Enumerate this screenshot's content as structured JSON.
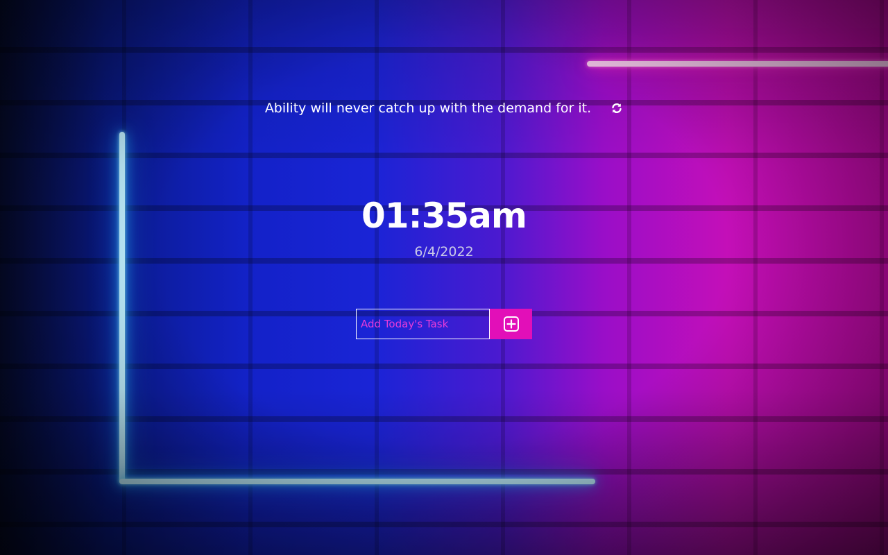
{
  "quote": {
    "text": "Ability will never catch up with the demand for it."
  },
  "clock": {
    "time": "01:35am",
    "date": "6/4/2022"
  },
  "task": {
    "placeholder": "Add Today's Task"
  },
  "icons": {
    "refresh": "refresh-icon",
    "add": "plus-square-icon"
  },
  "colors": {
    "accent": "#e20fb8",
    "placeholder": "#e63bd9"
  }
}
